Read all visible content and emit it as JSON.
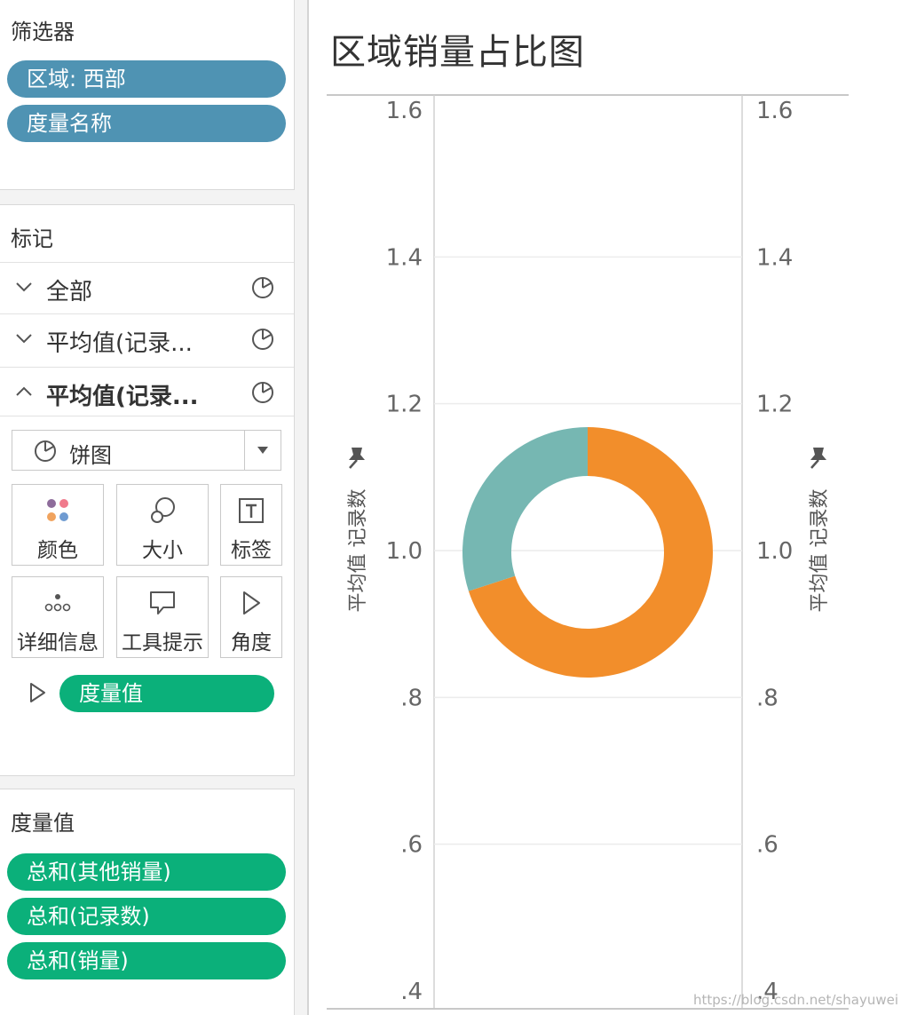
{
  "filters": {
    "title": "筛选器",
    "pills": [
      "区域: 西部",
      "度量名称"
    ]
  },
  "marks": {
    "title": "标记",
    "rows": [
      {
        "label": "全部",
        "expanded": false
      },
      {
        "label": "平均值(记录...",
        "expanded": false
      },
      {
        "label": "平均值(记录...",
        "expanded": true
      }
    ],
    "mark_type": "饼图",
    "buttons": [
      "颜色",
      "大小",
      "标签",
      "详细信息",
      "工具提示",
      "角度"
    ],
    "angle_field": "度量值"
  },
  "measure_values": {
    "title": "度量值",
    "pills": [
      "总和(其他销量)",
      "总和(记录数)",
      "总和(销量)"
    ]
  },
  "colors": {
    "pill_blue": "#4f93b3",
    "pill_green": "#0bb07a",
    "slice_orange": "#f28e2b",
    "slice_teal": "#76b7b2"
  },
  "chart_data": {
    "type": "pie",
    "title": "区域销量占比图",
    "ylabel_left": "平均值 记录数",
    "ylabel_right": "平均值 记录数",
    "y_ticks": [
      "1.6",
      "1.4",
      "1.2",
      "1.0",
      ".8",
      ".6",
      ".4"
    ],
    "y_tick_values": [
      1.6,
      1.4,
      1.2,
      1.0,
      0.8,
      0.6,
      0.4
    ],
    "ylim": [
      0.4,
      1.6
    ],
    "grid": true,
    "donut": true,
    "slices": [
      {
        "share": 0.7,
        "color": "#f28e2b"
      },
      {
        "share": 0.3,
        "color": "#76b7b2"
      }
    ]
  },
  "watermark": "https://blog.csdn.net/shayuwei"
}
